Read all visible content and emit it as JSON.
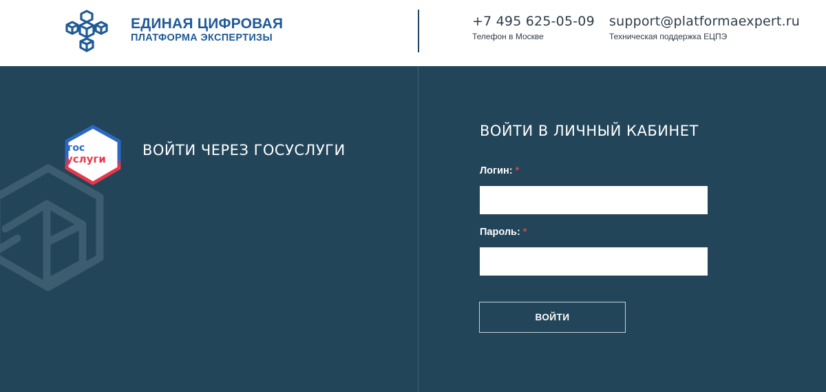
{
  "header": {
    "logo_icon": "cubes-logo-icon",
    "title_line1": "ЕДИНАЯ ЦИФРОВАЯ",
    "title_line2": "ПЛАТФОРМА ЭКСПЕРТИЗЫ",
    "phone": "+7 495 625-05-09",
    "phone_caption": "Телефон в Москве",
    "email": "support@platformaexpert.ru",
    "email_caption": "Техническая поддержка ЕЦПЭ"
  },
  "gosuslugi": {
    "logo_line1": "гос",
    "logo_line2": "услуги",
    "link_label": "ВОЙТИ ЧЕРЕЗ ГОСУСЛУГИ"
  },
  "login_form": {
    "title": "ВОЙТИ В ЛИЧНЫЙ КАБИНЕТ",
    "login_label": "Логин:",
    "login_value": "",
    "password_label": "Пароль:",
    "password_value": "",
    "required_mark": "*",
    "submit_label": "ВОЙТИ"
  },
  "colors": {
    "brand_blue": "#1f5a96",
    "panel_background": "#224559",
    "required_red": "#e0404a",
    "gos_blue": "#2b68c4",
    "gos_red": "#e8374a"
  }
}
